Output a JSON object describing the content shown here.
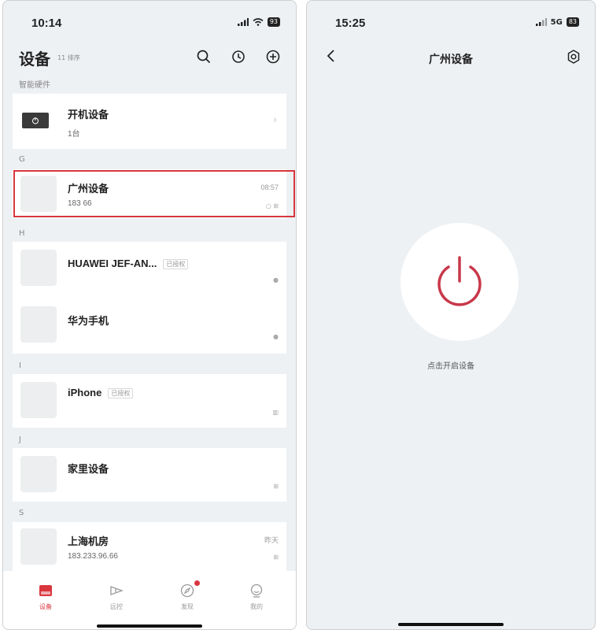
{
  "left_phone": {
    "status": {
      "time": "10:14",
      "battery": "93"
    },
    "header": {
      "title": "设备",
      "sort_hint": "11 排序"
    },
    "section_smart": "智能硬件",
    "power_on_device": {
      "name": "开机设备",
      "count": "1台"
    },
    "groups": [
      {
        "letter": "G",
        "items": [
          {
            "name": "广州设备",
            "sub": "183          66",
            "time": "08:57",
            "status_icons": "○ ⊞",
            "highlighted": true
          }
        ]
      },
      {
        "letter": "H",
        "items": [
          {
            "name": "HUAWEI JEF-AN...",
            "badge": "已授权",
            "status_icons": "●"
          },
          {
            "name": "华为手机",
            "status_icons": "●"
          }
        ]
      },
      {
        "letter": "I",
        "items": [
          {
            "name": "iPhone",
            "badge": "已授权",
            "status_icons": "▥"
          }
        ]
      },
      {
        "letter": "J",
        "items": [
          {
            "name": "家里设备",
            "status_icons": "⊞"
          }
        ]
      },
      {
        "letter": "S",
        "items": [
          {
            "name": "上海机房",
            "sub": "183.233.96.66",
            "time": "昨天",
            "status_icons": "⊞"
          }
        ]
      }
    ],
    "tabs": [
      {
        "label": "设备",
        "icon": "device-icon",
        "active": true
      },
      {
        "label": "远控",
        "icon": "remote-icon"
      },
      {
        "label": "发现",
        "icon": "discover-icon",
        "has_badge": true
      },
      {
        "label": "我的",
        "icon": "profile-icon"
      }
    ]
  },
  "right_phone": {
    "status": {
      "time": "15:25",
      "network": "5G",
      "battery": "83"
    },
    "title": "广州设备",
    "power_hint": "点击开启设备"
  },
  "colors": {
    "accent": "#d9363e",
    "background": "#eef1f4",
    "power_icon": "#c8384a"
  }
}
